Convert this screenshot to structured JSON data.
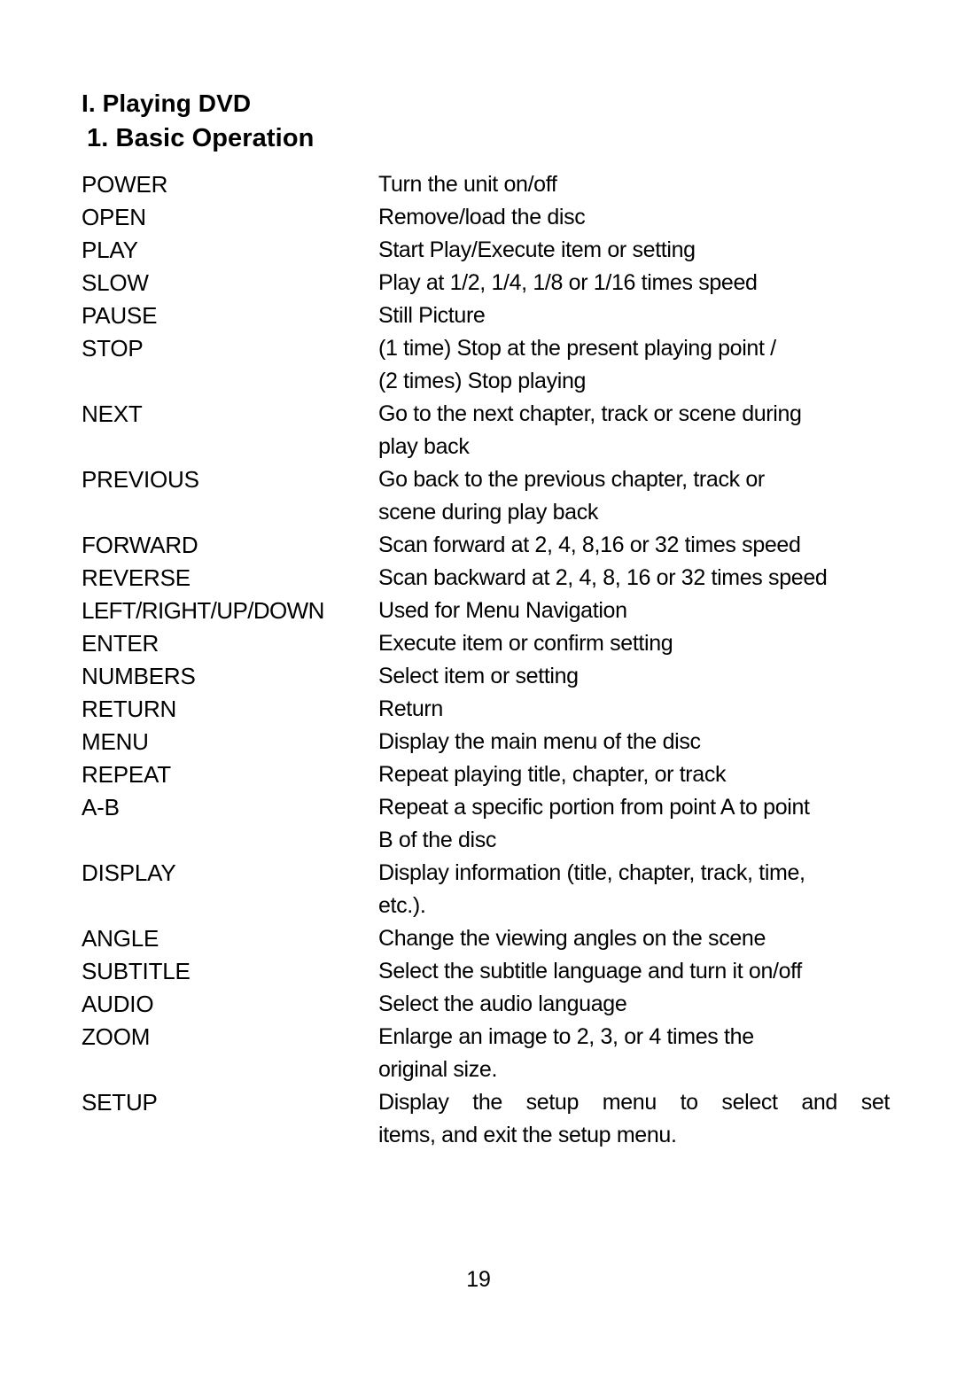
{
  "document": {
    "heading_section": "I. Playing DVD",
    "heading_subsection": "1. Basic Operation",
    "page_number": "19"
  },
  "operations": [
    {
      "term": "POWER",
      "lines": [
        "Turn the unit on/off"
      ]
    },
    {
      "term": "OPEN",
      "lines": [
        "Remove/load the disc"
      ]
    },
    {
      "term": "PLAY",
      "lines": [
        "Start Play/Execute item or setting"
      ]
    },
    {
      "term": "SLOW",
      "lines": [
        "Play at 1/2, 1/4, 1/8 or 1/16 times speed"
      ]
    },
    {
      "term": "PAUSE",
      "lines": [
        "Still Picture"
      ]
    },
    {
      "term": "STOP",
      "lines": [
        "(1 time) Stop at the present playing point /",
        "(2 times) Stop playing"
      ]
    },
    {
      "term": "NEXT",
      "lines": [
        "Go to the next chapter, track or scene during",
        "play back"
      ]
    },
    {
      "term": "PREVIOUS",
      "lines": [
        "Go back to the previous chapter, track or",
        "scene during play back"
      ]
    },
    {
      "term": "FORWARD",
      "lines": [
        "Scan forward at 2, 4, 8,16 or 32 times speed"
      ]
    },
    {
      "term": "REVERSE",
      "lines": [
        "Scan backward at 2, 4, 8, 16 or 32 times speed"
      ]
    },
    {
      "term": "LEFT/RIGHT/UP/DOWN",
      "lines": [
        "Used for Menu Navigation"
      ]
    },
    {
      "term": "ENTER",
      "lines": [
        "Execute item or confirm setting"
      ]
    },
    {
      "term": "NUMBERS",
      "lines": [
        "Select item or setting"
      ]
    },
    {
      "term": "RETURN",
      "lines": [
        "Return"
      ]
    },
    {
      "term": "MENU",
      "lines": [
        "Display the main menu of the disc"
      ]
    },
    {
      "term": "REPEAT",
      "lines": [
        "Repeat playing title, chapter, or track"
      ]
    },
    {
      "term": "A-B",
      "lines": [
        "Repeat a specific portion from point A to point",
        "B of  the disc"
      ]
    },
    {
      "term": "DISPLAY",
      "lines": [
        "Display information (title, chapter, track, time,",
        "etc.)."
      ]
    },
    {
      "term": "ANGLE",
      "lines": [
        "Change the viewing angles on the scene"
      ]
    },
    {
      "term": "SUBTITLE",
      "lines": [
        "Select the subtitle language and turn it on/off"
      ]
    },
    {
      "term": "AUDIO",
      "lines": [
        "Select the audio language"
      ]
    },
    {
      "term": "ZOOM",
      "lines": [
        "Enlarge an image to 2, 3, or 4 times the",
        "original size."
      ]
    },
    {
      "term": "SETUP",
      "lines": [
        "Display the setup menu to select and set",
        "items, and exit the setup menu."
      ]
    }
  ]
}
